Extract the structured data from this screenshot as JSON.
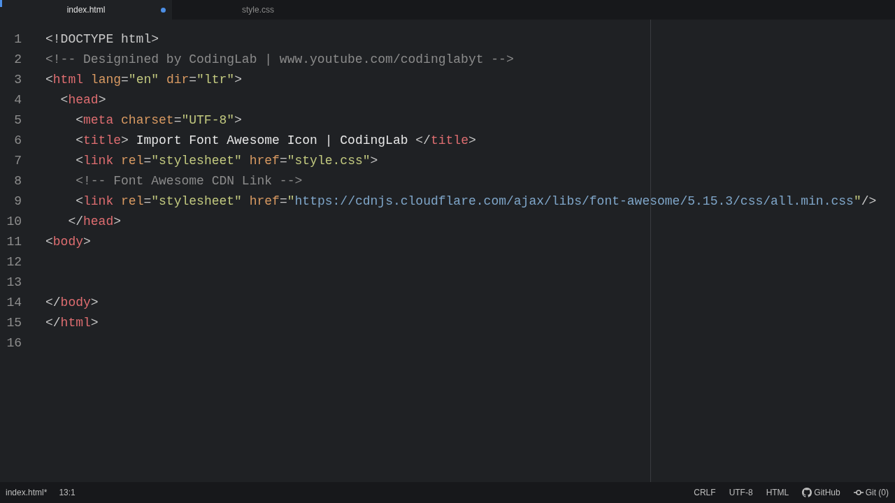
{
  "tabs": [
    {
      "label": "index.html",
      "selected": true,
      "modified": true
    },
    {
      "label": "style.css",
      "selected": false,
      "modified": false
    }
  ],
  "editor": {
    "lines": [
      {
        "number": "1",
        "tokens": [
          {
            "kind": "punct",
            "text": "<!DOCTYPE html>"
          }
        ]
      },
      {
        "number": "2",
        "tokens": [
          {
            "kind": "comment",
            "text": "<!-- Designined by CodingLab | www.youtube.com/codinglabyt -->"
          }
        ]
      },
      {
        "number": "3",
        "tokens": [
          {
            "kind": "punct",
            "text": "<"
          },
          {
            "kind": "tag",
            "text": "html"
          },
          {
            "kind": "attr",
            "text": " lang"
          },
          {
            "kind": "punct",
            "text": "="
          },
          {
            "kind": "string",
            "text": "\"en\""
          },
          {
            "kind": "attr",
            "text": " dir"
          },
          {
            "kind": "punct",
            "text": "="
          },
          {
            "kind": "string",
            "text": "\"ltr\""
          },
          {
            "kind": "punct",
            "text": ">"
          }
        ]
      },
      {
        "number": "4",
        "tokens": [
          {
            "kind": "punct",
            "text": "  <"
          },
          {
            "kind": "tag",
            "text": "head"
          },
          {
            "kind": "punct",
            "text": ">"
          }
        ]
      },
      {
        "number": "5",
        "tokens": [
          {
            "kind": "punct",
            "text": "    <"
          },
          {
            "kind": "tag",
            "text": "meta"
          },
          {
            "kind": "attr",
            "text": " charset"
          },
          {
            "kind": "punct",
            "text": "="
          },
          {
            "kind": "string",
            "text": "\"UTF-8\""
          },
          {
            "kind": "punct",
            "text": ">"
          }
        ]
      },
      {
        "number": "6",
        "tokens": [
          {
            "kind": "punct",
            "text": "    <"
          },
          {
            "kind": "tag",
            "text": "title"
          },
          {
            "kind": "punct",
            "text": ">"
          },
          {
            "kind": "text",
            "text": " Import Font Awesome Icon | CodingLab "
          },
          {
            "kind": "punct",
            "text": "</"
          },
          {
            "kind": "tag",
            "text": "title"
          },
          {
            "kind": "punct",
            "text": ">"
          }
        ]
      },
      {
        "number": "7",
        "tokens": [
          {
            "kind": "punct",
            "text": "    <"
          },
          {
            "kind": "tag",
            "text": "link"
          },
          {
            "kind": "attr",
            "text": " rel"
          },
          {
            "kind": "punct",
            "text": "="
          },
          {
            "kind": "string",
            "text": "\"stylesheet\""
          },
          {
            "kind": "attr",
            "text": " href"
          },
          {
            "kind": "punct",
            "text": "="
          },
          {
            "kind": "string",
            "text": "\"style.css\""
          },
          {
            "kind": "punct",
            "text": ">"
          }
        ]
      },
      {
        "number": "8",
        "tokens": [
          {
            "kind": "comment",
            "text": "    <!-- Font Awesome CDN Link -->"
          }
        ]
      },
      {
        "number": "9",
        "tokens": [
          {
            "kind": "punct",
            "text": "    <"
          },
          {
            "kind": "tag",
            "text": "link"
          },
          {
            "kind": "attr",
            "text": " rel"
          },
          {
            "kind": "punct",
            "text": "="
          },
          {
            "kind": "string",
            "text": "\"stylesheet\""
          },
          {
            "kind": "attr",
            "text": " href"
          },
          {
            "kind": "punct",
            "text": "="
          },
          {
            "kind": "string",
            "text": "\""
          },
          {
            "kind": "url",
            "text": "https://cdnjs.cloudflare.com/ajax/libs/font-awesome/5.15.3/css/all.min.css"
          },
          {
            "kind": "string",
            "text": "\""
          },
          {
            "kind": "punct",
            "text": "/>"
          }
        ]
      },
      {
        "number": "10",
        "tokens": [
          {
            "kind": "punct",
            "text": "   </"
          },
          {
            "kind": "tag",
            "text": "head"
          },
          {
            "kind": "punct",
            "text": ">"
          }
        ]
      },
      {
        "number": "11",
        "tokens": [
          {
            "kind": "punct",
            "text": "<"
          },
          {
            "kind": "tag",
            "text": "body"
          },
          {
            "kind": "punct",
            "text": ">"
          }
        ]
      },
      {
        "number": "12"
      },
      {
        "number": "13"
      },
      {
        "number": "14",
        "tokens": [
          {
            "kind": "punct",
            "text": "</"
          },
          {
            "kind": "tag",
            "text": "body"
          },
          {
            "kind": "punct",
            "text": ">"
          }
        ]
      },
      {
        "number": "15",
        "tokens": [
          {
            "kind": "punct",
            "text": "</"
          },
          {
            "kind": "tag",
            "text": "html"
          },
          {
            "kind": "punct",
            "text": ">"
          }
        ]
      },
      {
        "number": "16"
      }
    ]
  },
  "status_bar": {
    "left": [
      "index.html*",
      "13:1"
    ],
    "right": [
      {
        "kind": "text",
        "label": "CRLF"
      },
      {
        "kind": "text",
        "label": "UTF-8"
      },
      {
        "kind": "text",
        "label": "HTML"
      },
      {
        "kind": "github",
        "label": "GitHub"
      },
      {
        "kind": "git",
        "label": "Git (0)"
      }
    ]
  }
}
